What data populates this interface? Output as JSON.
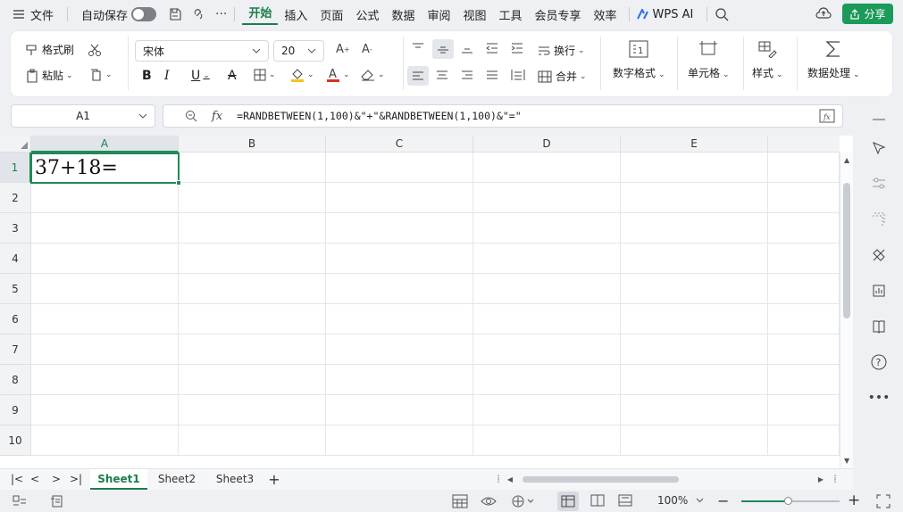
{
  "menu": {
    "file": "文件",
    "autosave": "自动保存",
    "tabs": [
      "开始",
      "插入",
      "页面",
      "公式",
      "数据",
      "审阅",
      "视图",
      "工具",
      "会员专享",
      "效率"
    ],
    "wps_ai": "WPS AI",
    "share": "分享"
  },
  "ribbon": {
    "format_painter": "格式刷",
    "paste": "粘贴",
    "font_name": "宋体",
    "font_size": "20",
    "wrap": "换行",
    "merge": "合并",
    "number_format": "数字格式",
    "cell": "单元格",
    "style": "样式",
    "data_process": "数据处理"
  },
  "formula_bar": {
    "name_box": "A1",
    "fx": "fx",
    "formula": "=RANDBETWEEN(1,100)&\"+\"&RANDBETWEEN(1,100)&\"=\""
  },
  "sheet": {
    "columns": [
      "A",
      "B",
      "C",
      "D",
      "E"
    ],
    "rows": [
      "1",
      "2",
      "3",
      "4",
      "5",
      "6",
      "7",
      "8",
      "9",
      "10"
    ],
    "a1_value": "37+18="
  },
  "sheet_tabs": [
    "Sheet1",
    "Sheet2",
    "Sheet3"
  ],
  "status": {
    "zoom": "100%"
  },
  "colors": {
    "accent": "#1b7f4b",
    "selection": "#1f8a55"
  }
}
